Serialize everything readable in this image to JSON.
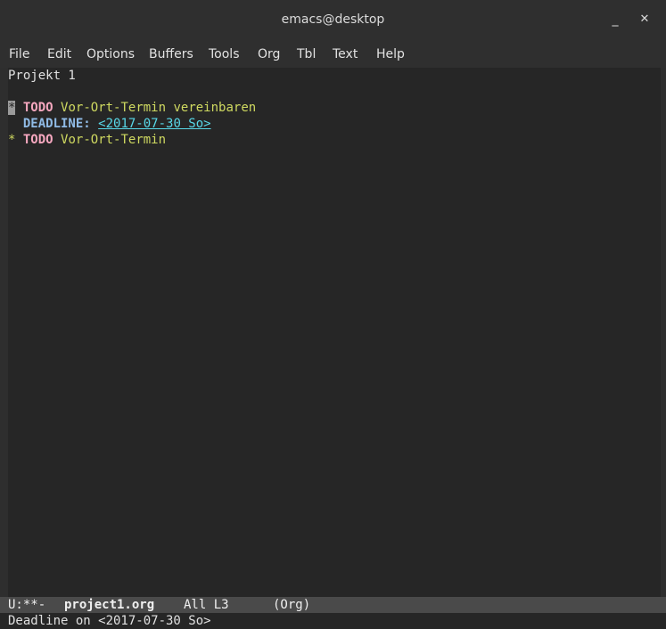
{
  "window": {
    "title": "emacs@desktop",
    "minimize_glyph": "_",
    "close_glyph": "✕"
  },
  "menu": {
    "items": [
      "File",
      "Edit",
      "Options",
      "Buffers",
      "Tools",
      "Org",
      "Tbl",
      "Text",
      "Help"
    ]
  },
  "buffer": {
    "line1": "Projekt 1",
    "line2": "",
    "line3": {
      "star": "*",
      "todo": "TODO",
      "heading": "Vor-Ort-Termin vereinbaren"
    },
    "line4": {
      "keyword": "DEADLINE:",
      "date": "<2017-07-30 So>"
    },
    "line5": {
      "star": "*",
      "todo": "TODO",
      "heading": "Vor-Ort-Termin"
    }
  },
  "modeline": {
    "status": "U:**-",
    "buffer_name": "project1.org",
    "position": "All L3",
    "mode": "(Org)"
  },
  "echo": {
    "message": "Deadline on <2017-07-30 So>"
  },
  "colors": {
    "background": "#262626",
    "chrome": "#2f2f2f",
    "todo": "#f7a8c0",
    "heading": "#cfd960",
    "deadline": "#90bbe6",
    "date_link": "#58d8e8",
    "modeline": "#4a4a4a"
  }
}
